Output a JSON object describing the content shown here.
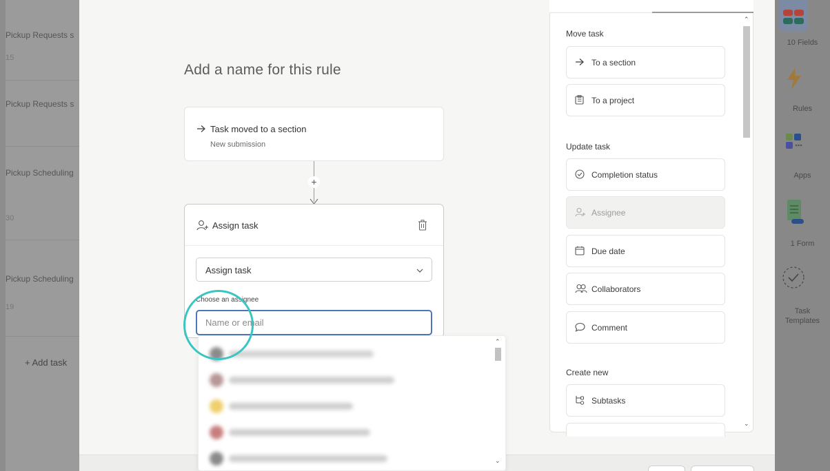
{
  "background": {
    "left_list": [
      {
        "title": "Pickup Requests s",
        "sub": "15"
      },
      {
        "title": "Pickup Requests s",
        "sub": ""
      },
      {
        "title": "Pickup Scheduling",
        "sub": "30"
      },
      {
        "title": "Pickup Scheduling",
        "sub": "19"
      }
    ],
    "add_task": "+ Add task",
    "rail": {
      "fields": "10 Fields",
      "rules": "Rules",
      "apps": "Apps",
      "form": "1 Form",
      "task_templates_1": "Task",
      "task_templates_2": "Templates"
    }
  },
  "rule": {
    "name_placeholder": "Add a name for this rule",
    "trigger": {
      "title": "Task moved to a section",
      "subtitle": "New submission"
    },
    "connector_plus": "+",
    "action": {
      "title": "Assign task",
      "select_value": "Assign task",
      "field_label": "Choose an assignee",
      "input_placeholder": "Name or email"
    }
  },
  "panel": {
    "sections": [
      {
        "title": "Move task",
        "options": [
          {
            "label": "To a section",
            "icon": "arrow-right-icon",
            "disabled": false
          },
          {
            "label": "To a project",
            "icon": "project-icon",
            "disabled": false
          }
        ]
      },
      {
        "title": "Update task",
        "options": [
          {
            "label": "Completion status",
            "icon": "check-circle-icon",
            "disabled": false
          },
          {
            "label": "Assignee",
            "icon": "assignee-icon",
            "disabled": true
          },
          {
            "label": "Due date",
            "icon": "calendar-icon",
            "disabled": false
          },
          {
            "label": "Collaborators",
            "icon": "collaborators-icon",
            "disabled": false
          },
          {
            "label": "Comment",
            "icon": "comment-icon",
            "disabled": false
          }
        ]
      },
      {
        "title": "Create new",
        "options": [
          {
            "label": "Subtasks",
            "icon": "subtasks-icon",
            "disabled": false
          }
        ]
      }
    ]
  },
  "colors": {
    "focus_border": "#4f74b8",
    "highlight_ring": "#39c5c2",
    "modal_bg": "#f6f6f5"
  }
}
